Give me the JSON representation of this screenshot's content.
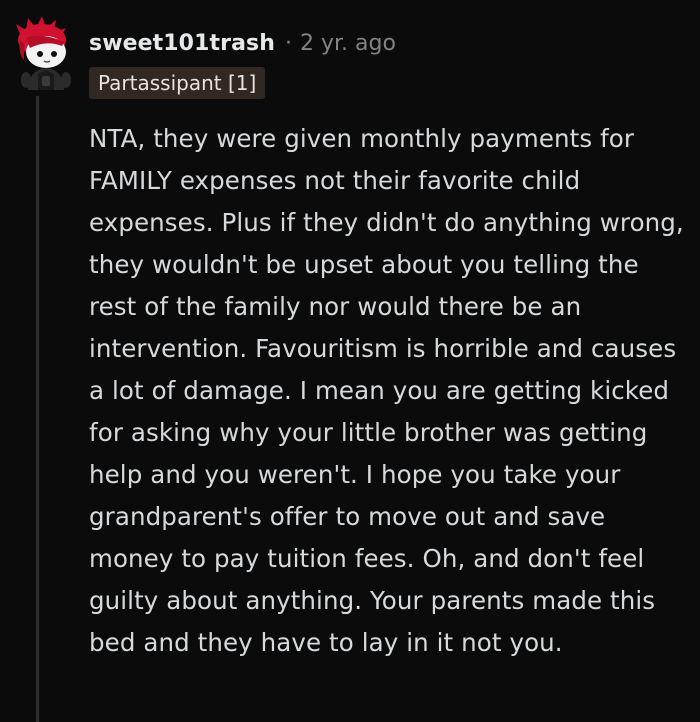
{
  "comment": {
    "author": "sweet101trash",
    "separator": "·",
    "age": "2 yr. ago",
    "flair": "Partassipant [1]",
    "avatar_icon": "snoo-avatar-icon",
    "body": "NTA, they were given monthly payments for FAMILY expenses not their favorite child expenses. Plus if they didn't do anything wrong, they wouldn't be upset about you telling the rest of the family nor would there be an intervention. Favouritism is horrible and causes a lot of damage. I mean you are getting kicked for asking why your little brother was getting help and you weren't. I hope you take your grandparent's offer to move out and save money to pay tuition fees. Oh, and don't feel guilty about anything. Your parents made this bed and they have to lay in it not you."
  },
  "colors": {
    "background": "#0b0b0b",
    "text": "#d7dadc",
    "meta": "#818384",
    "flair_bg": "#312723",
    "thread_line": "#2e2e2e",
    "avatar_hair": "#c8102e"
  }
}
